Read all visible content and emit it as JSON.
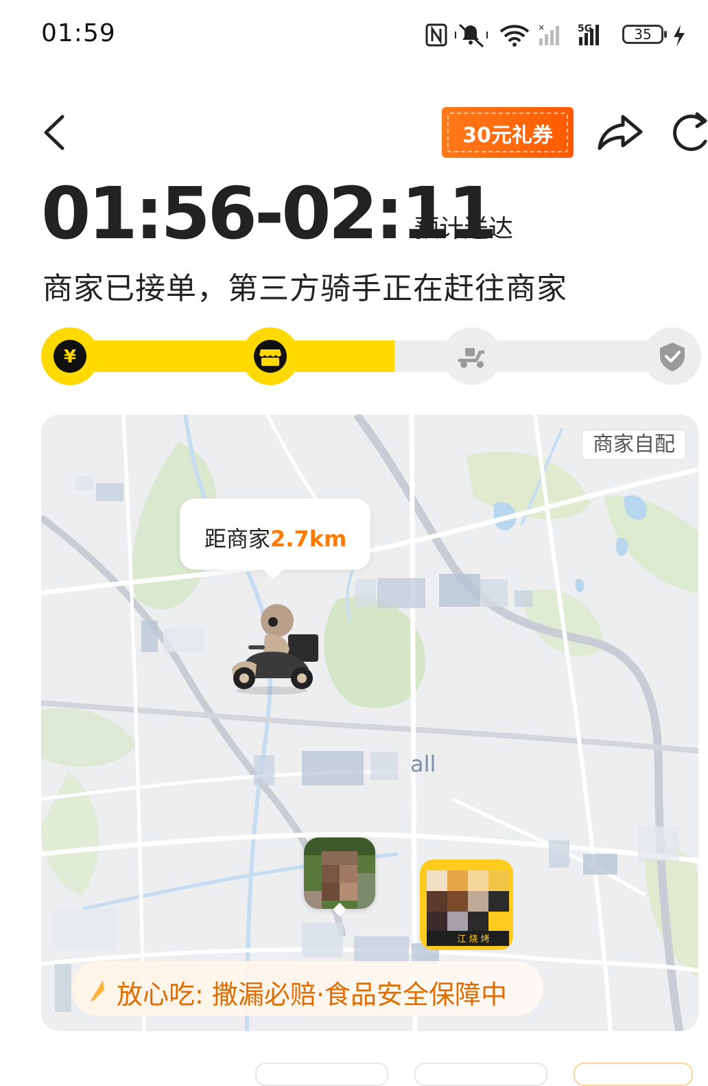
{
  "status_bar": {
    "time": "01:59",
    "battery": "35",
    "network": "5G",
    "icons": [
      "nfc-icon",
      "mute-icon",
      "wifi-icon",
      "signal-icon",
      "signal-5g-icon",
      "battery-icon",
      "charging-icon"
    ]
  },
  "header": {
    "back_icon": "chevron-left-icon",
    "coupon_label": "30元礼券",
    "share_icon": "share-icon",
    "refresh_icon": "refresh-icon"
  },
  "delivery": {
    "eta_range": "01:56-02:11",
    "eta_suffix": "预计送达",
    "status_message": "商家已接单，第三方骑手正在赶往商家"
  },
  "progress": {
    "steps": [
      {
        "icon": "yen-icon",
        "state": "done"
      },
      {
        "icon": "shop-icon",
        "state": "active"
      },
      {
        "icon": "scooter-icon",
        "state": "pending"
      },
      {
        "icon": "check-icon",
        "state": "pending"
      }
    ],
    "filled_fraction": 0.546
  },
  "map": {
    "self_delivery_tag": "商家自配",
    "rider_bubble": {
      "prefix": "距商家",
      "distance": "2.7km"
    },
    "poi_label_fragment": "all",
    "assurance_text": "放心吃: 撒漏必赔·食品安全保障中",
    "shop_sign_text": "江 烧 烤"
  },
  "colors": {
    "brand_yellow": "#ffd900",
    "accent_orange": "#ff7a00",
    "coupon_orange": "#ff5a00",
    "text_dark": "#222222"
  }
}
